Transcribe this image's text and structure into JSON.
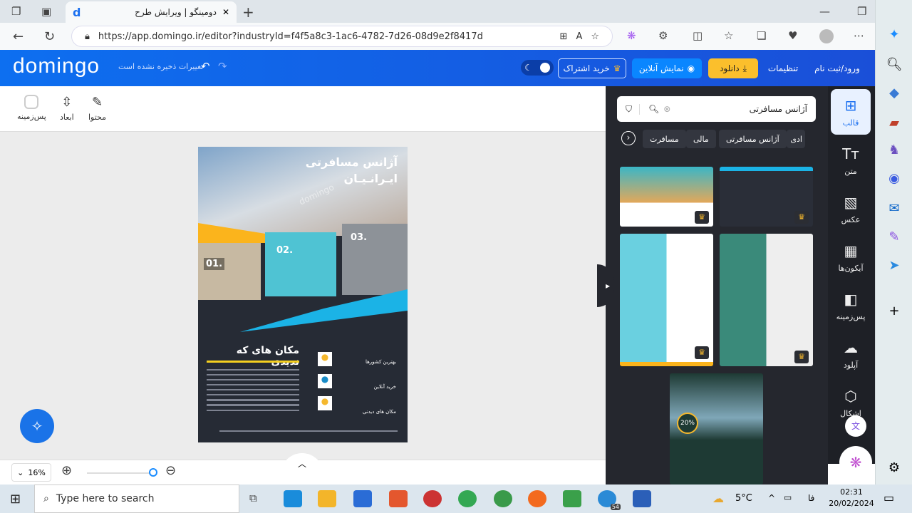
{
  "browser": {
    "tab_title": "دومینگو | ویرایش طرح",
    "url": "https://app.domingo.ir/editor?industryId=f4f5a8c3-1ac6-4782-7d26-08d9e2f8417d"
  },
  "header": {
    "logo": "domingo",
    "unsaved": "تغییرات ذخیره نشده است",
    "subscribe": "خرید اشتراک",
    "preview": "نمایش آنلاین",
    "download": "دانلود",
    "settings": "تنظیمات",
    "login": "ورود/ثبت نام",
    "accent": "#1a6ff0",
    "download_color": "#fbbf2c"
  },
  "tools": [
    {
      "label": "محتوا",
      "icon": "edit-icon"
    },
    {
      "label": "ابعاد",
      "icon": "resize-icon"
    },
    {
      "label": "پس‌زمینه",
      "icon": "background-icon"
    }
  ],
  "poster": {
    "title1": "آژانس مسافرتی",
    "title2": "ایـرانـیـان",
    "n1": "01.",
    "n2": "02.",
    "n3": "03.",
    "heading": "مکان های که ندیدی",
    "features": [
      "بهترین کشورها",
      "خرید آنلاین",
      "مکان های دیدنی"
    ],
    "watermark": "domingo"
  },
  "panel": {
    "search_value": "آژانس مسافرتی",
    "chips": [
      "ادی",
      "آژانس مسافرتی",
      "مالی",
      "مسافرت"
    ],
    "thumb_badge": "20%"
  },
  "rail": [
    {
      "label": "قالب",
      "icon": "template-icon"
    },
    {
      "label": "متن",
      "icon": "text-icon"
    },
    {
      "label": "عکس",
      "icon": "image-icon"
    },
    {
      "label": "آیکون‌ها",
      "icon": "grid-icon"
    },
    {
      "label": "پس‌زمینه",
      "icon": "background-icon"
    },
    {
      "label": "آپلود",
      "icon": "upload-icon"
    },
    {
      "label": "اشکال",
      "icon": "shapes-icon"
    }
  ],
  "zoom": {
    "level": "16%",
    "fraction": 0.16
  },
  "taskbar": {
    "search_placeholder": "Type here to search",
    "temp": "5°C",
    "lang": "فا",
    "time": "02:31",
    "date": "20/02/2024",
    "badge": "54"
  }
}
